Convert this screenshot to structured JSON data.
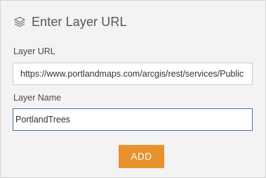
{
  "header": {
    "title": "Enter Layer URL",
    "icon": "layers-icon"
  },
  "layer_url": {
    "label": "Layer URL",
    "value": "https://www.portlandmaps.com/arcgis/rest/services/Public"
  },
  "layer_name": {
    "label": "Layer Name",
    "value": "PortlandTrees"
  },
  "add_button": {
    "label": "ADD"
  },
  "colors": {
    "panel_background": "#f3f3f3",
    "button_accent": "#e8912d",
    "focus_border": "#4a6fa5"
  }
}
